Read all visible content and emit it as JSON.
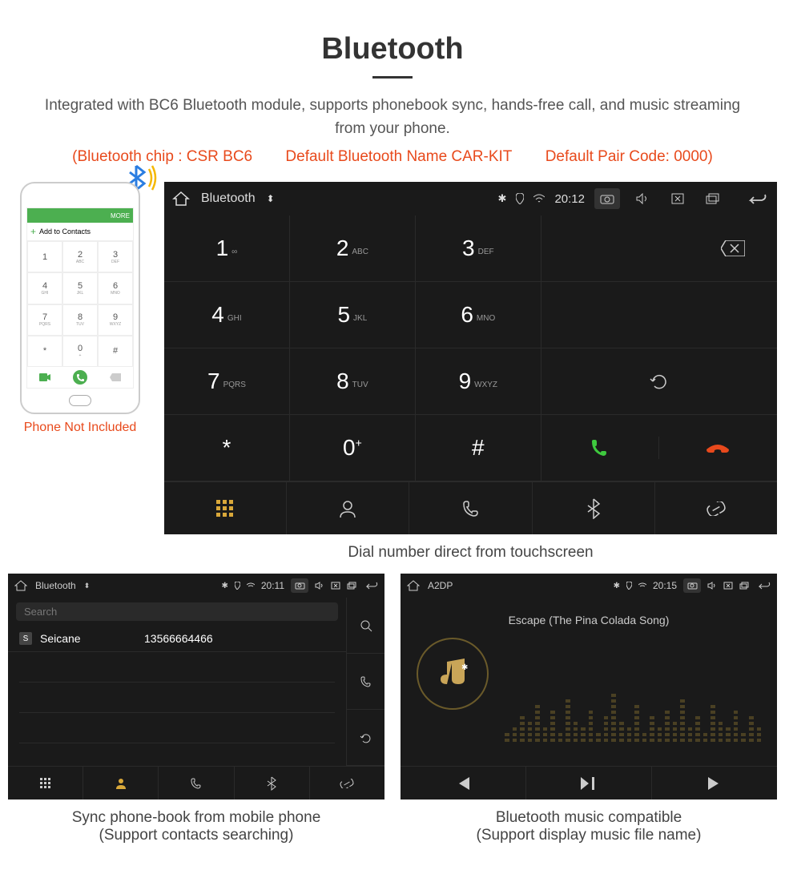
{
  "title": "Bluetooth",
  "description": "Integrated with BC6 Bluetooth module, supports phonebook sync, hands-free call, and music streaming from your phone.",
  "specs": {
    "chip": "(Bluetooth chip : CSR BC6",
    "name": "Default Bluetooth Name CAR-KIT",
    "code": "Default Pair Code: 0000)"
  },
  "phone_note": "Phone Not Included",
  "phone_mock": {
    "more": "MORE",
    "add_contacts": "Add to Contacts",
    "keys": [
      {
        "n": "1",
        "s": ""
      },
      {
        "n": "2",
        "s": "ABC"
      },
      {
        "n": "3",
        "s": "DEF"
      },
      {
        "n": "4",
        "s": "GHI"
      },
      {
        "n": "5",
        "s": "JKL"
      },
      {
        "n": "6",
        "s": "MNO"
      },
      {
        "n": "7",
        "s": "PQRS"
      },
      {
        "n": "8",
        "s": "TUV"
      },
      {
        "n": "9",
        "s": "WXYZ"
      },
      {
        "n": "*",
        "s": ""
      },
      {
        "n": "0",
        "s": "+"
      },
      {
        "n": "#",
        "s": ""
      }
    ]
  },
  "main_device": {
    "app_title": "Bluetooth",
    "time": "20:12",
    "keys": [
      {
        "n": "1",
        "s": "∞"
      },
      {
        "n": "2",
        "s": "ABC"
      },
      {
        "n": "3",
        "s": "DEF"
      },
      {
        "n": "4",
        "s": "GHI"
      },
      {
        "n": "5",
        "s": "JKL"
      },
      {
        "n": "6",
        "s": "MNO"
      },
      {
        "n": "7",
        "s": "PQRS"
      },
      {
        "n": "8",
        "s": "TUV"
      },
      {
        "n": "9",
        "s": "WXYZ"
      },
      {
        "n": "*",
        "s": ""
      },
      {
        "n": "0",
        "s": "+"
      },
      {
        "n": "#",
        "s": ""
      }
    ],
    "caption": "Dial number direct from touchscreen"
  },
  "phonebook": {
    "app_title": "Bluetooth",
    "time": "20:11",
    "search_placeholder": "Search",
    "contact_name": "Seicane",
    "contact_number": "13566664466",
    "caption_1": "Sync phone-book from mobile phone",
    "caption_2": "(Support contacts searching)"
  },
  "music": {
    "app_title": "A2DP",
    "time": "20:15",
    "song": "Escape (The Pina Colada Song)",
    "caption_1": "Bluetooth music compatible",
    "caption_2": "(Support display music file name)"
  }
}
